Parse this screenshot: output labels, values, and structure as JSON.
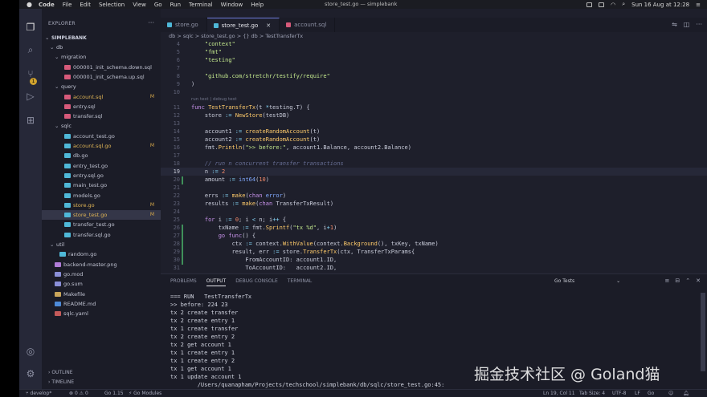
{
  "menubar": {
    "apple": "",
    "items": [
      "Code",
      "File",
      "Edit",
      "Selection",
      "View",
      "Go",
      "Run",
      "Terminal",
      "Window",
      "Help"
    ],
    "window_title": "store_test.go — simplebank",
    "clock": "Sun 16 Aug at 12:28"
  },
  "activity_bar": {
    "items": [
      "explorer-icon",
      "search-icon",
      "source-control-icon",
      "run-icon",
      "extensions-icon"
    ],
    "badge": "1",
    "bottom": [
      "account-icon",
      "gear-icon"
    ]
  },
  "sidebar": {
    "header": "EXPLORER",
    "root": "SIMPLEBANK",
    "tree": [
      {
        "label": "db",
        "depth": 1,
        "folder": true,
        "open": true
      },
      {
        "label": "migration",
        "depth": 2,
        "folder": true,
        "open": true
      },
      {
        "label": "000001_init_schema.down.sql",
        "depth": 3,
        "type": "sql"
      },
      {
        "label": "000001_init_schema.up.sql",
        "depth": 3,
        "type": "sql"
      },
      {
        "label": "query",
        "depth": 2,
        "folder": true,
        "open": true
      },
      {
        "label": "account.sql",
        "depth": 3,
        "type": "sql",
        "mod": "M"
      },
      {
        "label": "entry.sql",
        "depth": 3,
        "type": "sql"
      },
      {
        "label": "transfer.sql",
        "depth": 3,
        "type": "sql"
      },
      {
        "label": "sqlc",
        "depth": 2,
        "folder": true,
        "open": true
      },
      {
        "label": "account_test.go",
        "depth": 3,
        "type": "go"
      },
      {
        "label": "account.sql.go",
        "depth": 3,
        "type": "go",
        "mod": "M"
      },
      {
        "label": "db.go",
        "depth": 3,
        "type": "go"
      },
      {
        "label": "entry_test.go",
        "depth": 3,
        "type": "go"
      },
      {
        "label": "entry.sql.go",
        "depth": 3,
        "type": "go"
      },
      {
        "label": "main_test.go",
        "depth": 3,
        "type": "go"
      },
      {
        "label": "models.go",
        "depth": 3,
        "type": "go"
      },
      {
        "label": "store.go",
        "depth": 3,
        "type": "go",
        "mod": "M"
      },
      {
        "label": "store_test.go",
        "depth": 3,
        "type": "go",
        "mod": "M",
        "selected": true
      },
      {
        "label": "transfer_test.go",
        "depth": 3,
        "type": "go"
      },
      {
        "label": "transfer.sql.go",
        "depth": 3,
        "type": "go"
      },
      {
        "label": "util",
        "depth": 1,
        "folder": true,
        "open": true
      },
      {
        "label": "random.go",
        "depth": 2,
        "type": "go"
      },
      {
        "label": "backend-master.png",
        "depth": 1,
        "type": "png"
      },
      {
        "label": "go.mod",
        "depth": 1,
        "type": "mod"
      },
      {
        "label": "go.sum",
        "depth": 1,
        "type": "mod"
      },
      {
        "label": "Makefile",
        "depth": 1,
        "type": "make"
      },
      {
        "label": "README.md",
        "depth": 1,
        "type": "md"
      },
      {
        "label": "sqlc.yaml",
        "depth": 1,
        "type": "yaml"
      }
    ],
    "outline": "OUTLINE",
    "timeline": "TIMELINE"
  },
  "tabs": [
    {
      "label": "store.go",
      "type": "go"
    },
    {
      "label": "store_test.go",
      "type": "go",
      "active": true
    },
    {
      "label": "account.sql",
      "type": "sql"
    }
  ],
  "breadcrumb": "db > sqlc > store_test.go > {} db > TestTransferTx",
  "editor": {
    "lines": [
      {
        "n": "4",
        "html": "    <span class='s'>\"context\"</span>"
      },
      {
        "n": "5",
        "html": "    <span class='s'>\"fmt\"</span>"
      },
      {
        "n": "6",
        "html": "    <span class='s'>\"testing\"</span>"
      },
      {
        "n": "7",
        "html": ""
      },
      {
        "n": "8",
        "html": "    <span class='s'>\"github.com/stretchr/testify/require\"</span>"
      },
      {
        "n": "9",
        "html": ")"
      },
      {
        "n": "10",
        "html": ""
      },
      {
        "n": "11",
        "html": "<span class='k'>func</span> <span class='f'>TestTransferTx</span>(t <span class='o'>*</span>testing.T) {",
        "lens": "run test | debug test"
      },
      {
        "n": "12",
        "html": "    store <span class='o'>:=</span> <span class='f'>NewStore</span>(testDB)"
      },
      {
        "n": "13",
        "html": ""
      },
      {
        "n": "14",
        "html": "    account1 <span class='o'>:=</span> <span class='f'>createRandomAccount</span>(t)"
      },
      {
        "n": "15",
        "html": "    account2 <span class='o'>:=</span> <span class='f'>createRandomAccount</span>(t)"
      },
      {
        "n": "16",
        "html": "    fmt.<span class='f'>Println</span>(<span class='s'>\">> before:\"</span>, account1.Balance, account2.Balance)"
      },
      {
        "n": "17",
        "html": ""
      },
      {
        "n": "18",
        "html": "    <span class='c'>// run n concurrent transfer transactions</span>"
      },
      {
        "n": "19",
        "html": "    n <span class='o'>:=</span> <span class='n'>2</span>",
        "cur": true
      },
      {
        "n": "20",
        "html": "    amount <span class='o'>:=</span> <span class='t'>int64</span>(<span class='n'>10</span>)"
      },
      {
        "n": "21",
        "html": ""
      },
      {
        "n": "22",
        "html": "    errs <span class='o'>:=</span> <span class='f'>make</span>(<span class='k'>chan</span> <span class='t'>error</span>)"
      },
      {
        "n": "23",
        "html": "    results <span class='o'>:=</span> <span class='f'>make</span>(<span class='k'>chan</span> TransferTxResult)"
      },
      {
        "n": "24",
        "html": ""
      },
      {
        "n": "25",
        "html": "    <span class='k'>for</span> i <span class='o'>:=</span> <span class='n'>0</span>; i <span class='o'>&lt;</span> n; i<span class='o'>++</span> {"
      },
      {
        "n": "26",
        "html": "        txName <span class='o'>:=</span> fmt.<span class='f'>Sprintf</span>(<span class='s'>\"tx %d\"</span>, i<span class='o'>+</span><span class='n'>1</span>)"
      },
      {
        "n": "27",
        "html": "        <span class='k'>go</span> <span class='k'>func</span>() {"
      },
      {
        "n": "28",
        "html": "            ctx <span class='o'>:=</span> context.<span class='f'>WithValue</span>(context.<span class='f'>Background</span>(), txKey, txName)"
      },
      {
        "n": "29",
        "html": "            result, err <span class='o'>:=</span> store.<span class='f'>TransferTx</span>(ctx, TransferTxParams{"
      },
      {
        "n": "30",
        "html": "                FromAccountID: account1.ID,"
      },
      {
        "n": "31",
        "html": "                ToAccountID:   account2.ID,"
      }
    ]
  },
  "panel": {
    "tabs": [
      "PROBLEMS",
      "OUTPUT",
      "DEBUG CONSOLE",
      "TERMINAL"
    ],
    "active_tab": "OUTPUT",
    "select": "Go Tests",
    "output": [
      "=== RUN   TestTransferTx",
      ">> before: 224 23",
      "tx 2 create transfer",
      "tx 2 create entry 1",
      "tx 1 create transfer",
      "tx 2 create entry 2",
      "tx 2 get account 1",
      "tx 1 create entry 1",
      "tx 1 create entry 2",
      "tx 1 get account 1",
      "tx 1 update account 1",
      "        /Users/quanapham/Projects/techschool/simplebank/db/sqlc/store_test.go:45:"
    ]
  },
  "statusbar": {
    "branch": "develop*",
    "errors": "0",
    "warnings": "0",
    "go_version": "Go 1.15",
    "modules": "Go Modules",
    "position": "Ln 19, Col 11",
    "tabsize": "Tab Size: 4",
    "encoding": "UTF-8",
    "eol": "LF",
    "lang": "Go"
  },
  "watermark": "掘金技术社区 @ Goland猫"
}
